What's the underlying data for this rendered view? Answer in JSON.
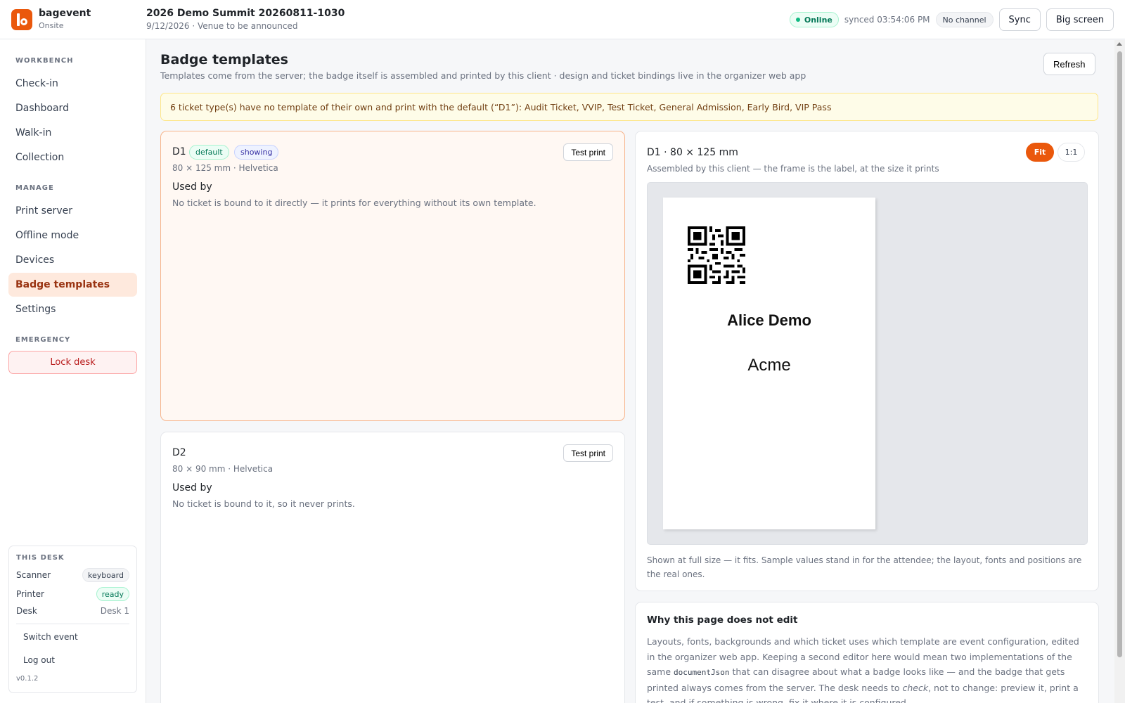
{
  "app": {
    "name": "bagevent",
    "mode": "Onsite"
  },
  "event": {
    "title": "2026 Demo Summit 20260811-1030",
    "subtitle": "9/12/2026 · Venue to be announced"
  },
  "header": {
    "status": "Online",
    "synced": "synced 03:54:06 PM",
    "channel": "No channel",
    "sync_label": "Sync",
    "big_screen_label": "Big screen"
  },
  "sidebar": {
    "sections": {
      "workbench": "WORKBENCH",
      "manage": "MANAGE",
      "emergency": "EMERGENCY"
    },
    "items": {
      "checkin": "Check-in",
      "dashboard": "Dashboard",
      "walkin": "Walk-in",
      "collection": "Collection",
      "print_server": "Print server",
      "offline_mode": "Offline mode",
      "devices": "Devices",
      "badge_templates": "Badge templates",
      "settings": "Settings"
    },
    "active": "badge_templates",
    "lock_label": "Lock desk",
    "desk": {
      "title": "THIS DESK",
      "scanner_label": "Scanner",
      "scanner_value": "keyboard",
      "printer_label": "Printer",
      "printer_value": "ready",
      "desk_label": "Desk",
      "desk_value": "Desk 1",
      "switch_event": "Switch event",
      "log_out": "Log out",
      "version": "v0.1.2"
    }
  },
  "page": {
    "title": "Badge templates",
    "subtitle": "Templates come from the server; the badge itself is assembled and printed by this client · design and ticket bindings live in the organizer web app",
    "refresh_label": "Refresh",
    "warning": "6 ticket type(s) have no template of their own and print with the default (“D1”): Audit Ticket, VVIP, Test Ticket, General Admission, Early Bird, VIP Pass"
  },
  "templates": [
    {
      "name": "D1",
      "tags": {
        "default": "default",
        "showing": "showing"
      },
      "meta": "80 × 125 mm · Helvetica",
      "used_by_label": "Used by",
      "used_by_text": "No ticket is bound to it directly — it prints for everything without its own template.",
      "test_print_label": "Test print"
    },
    {
      "name": "D2",
      "meta": "80 × 90 mm · Helvetica",
      "used_by_label": "Used by",
      "used_by_text": "No ticket is bound to it, so it never prints.",
      "test_print_label": "Test print"
    }
  ],
  "preview": {
    "title": "D1 · 80 × 125 mm",
    "subtitle": "Assembled by this client — the frame is the label, at the size it prints",
    "fit_label": "Fit",
    "one_to_one_label": "1:1",
    "sample_name": "Alice Demo",
    "sample_org": "Acme",
    "note": "Shown at full size — it fits. Sample values stand in for the attendee; the layout, fonts and positions are the real ones."
  },
  "why": {
    "title": "Why this page does not edit",
    "text_1": "Layouts, fonts, backgrounds and which ticket uses which template are event configuration, edited in the organizer web app. Keeping a second editor here would mean two implementations of the same ",
    "code": "documentJson",
    "text_2": " that can disagree about what a badge looks like — and the badge that gets printed always comes from the server. The desk needs to ",
    "em": "check",
    "text_3": ", not to change: preview it, print a test, and if something is wrong, fix it where it is configured."
  },
  "colors": {
    "accent": "#ea580c",
    "online": "#10b981",
    "selected_border": "#f6b48c"
  },
  "icons": {
    "logo": "bagevent-logo",
    "status": "status-dot-icon",
    "qr": "qr-code"
  }
}
